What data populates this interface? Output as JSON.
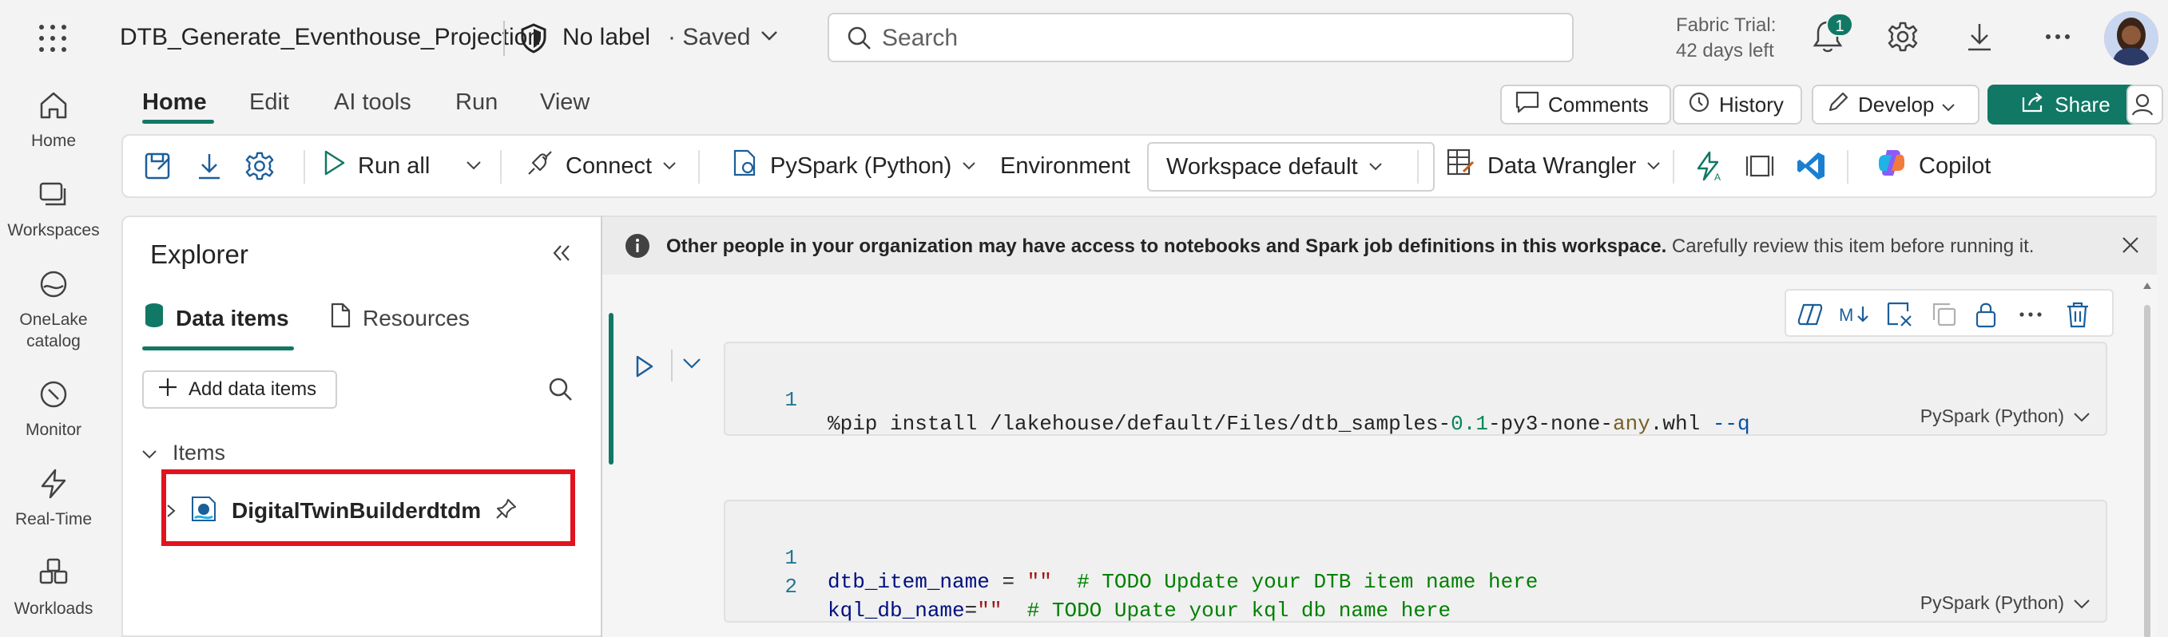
{
  "header": {
    "title": "DTB_Generate_Eventhouse_Projection",
    "sensitivity_label": "No label",
    "save_status": "· Saved",
    "search_placeholder": "Search",
    "trial_line1": "Fabric Trial:",
    "trial_line2": "42 days left",
    "notification_count": "1"
  },
  "rail": {
    "items": [
      {
        "label": "Home",
        "icon": "home-icon"
      },
      {
        "label": "Workspaces",
        "icon": "workspaces-icon"
      },
      {
        "label": "OneLake catalog",
        "icon": "onelake-icon"
      },
      {
        "label": "Monitor",
        "icon": "monitor-icon"
      },
      {
        "label": "Real-Time",
        "icon": "real-time-icon"
      },
      {
        "label": "Workloads",
        "icon": "workloads-icon"
      }
    ]
  },
  "menu": {
    "tabs": [
      "Home",
      "Edit",
      "AI tools",
      "Run",
      "View"
    ],
    "active_tab": "Home"
  },
  "actions": {
    "comments": "Comments",
    "history": "History",
    "develop": "Develop",
    "share": "Share"
  },
  "ribbon": {
    "run_all": "Run all",
    "connect": "Connect",
    "language": "PySpark (Python)",
    "environment_label": "Environment",
    "environment_value": "Workspace default",
    "data_wrangler": "Data Wrangler",
    "copilot": "Copilot"
  },
  "explorer": {
    "title": "Explorer",
    "tab_data": "Data items",
    "tab_resources": "Resources",
    "add_button": "Add data items",
    "section_label": "Items",
    "tree_items": [
      "DigitalTwinBuilderdtdm"
    ]
  },
  "notice": {
    "bold": "Other people in your organization may have access to notebooks and Spark job definitions in this workspace.",
    "rest": " Carefully review this item before running it."
  },
  "cells": [
    {
      "language": "PySpark (Python)",
      "lines": [
        {
          "num": "1",
          "tokens": [
            {
              "t": "%pip install /lakehouse/default/Files/dtb_samples-",
              "c": ""
            },
            {
              "t": "0.1",
              "c": "num"
            },
            {
              "t": "-py3-none-",
              "c": ""
            },
            {
              "t": "any",
              "c": "kw"
            },
            {
              "t": ".whl ",
              "c": ""
            },
            {
              "t": "--q",
              "c": "flag"
            }
          ]
        }
      ]
    },
    {
      "language": "PySpark (Python)",
      "lines": [
        {
          "num": "1",
          "tokens": [
            {
              "t": "dtb_item_name",
              "c": "var"
            },
            {
              "t": " = ",
              "c": ""
            },
            {
              "t": "\"\"",
              "c": "str"
            },
            {
              "t": "  # TODO Update your DTB item name here",
              "c": "cmt"
            }
          ]
        },
        {
          "num": "2",
          "tokens": [
            {
              "t": "kql_db_name",
              "c": "var"
            },
            {
              "t": "=",
              "c": ""
            },
            {
              "t": "\"\"",
              "c": "str"
            },
            {
              "t": "  # TODO Upate your kql db name here",
              "c": "cmt"
            }
          ]
        }
      ]
    }
  ],
  "colors": {
    "accent": "#117865",
    "highlight": "#e0141f"
  }
}
